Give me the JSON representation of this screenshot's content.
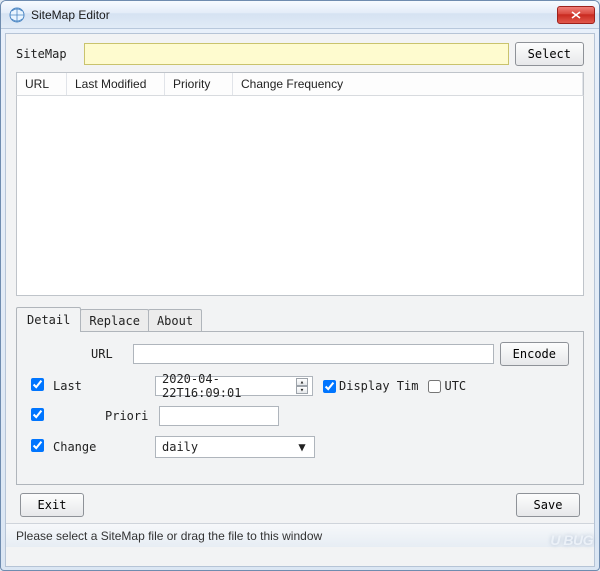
{
  "window": {
    "title": "SiteMap Editor"
  },
  "file_section": {
    "label": "SiteMap",
    "select_button": "Select",
    "path": ""
  },
  "grid": {
    "columns": {
      "url": "URL",
      "last_modified": "Last Modified",
      "priority": "Priority",
      "change_frequency": "Change Frequency"
    }
  },
  "tabs": {
    "detail": "Detail",
    "replace": "Replace",
    "about": "About"
  },
  "detail_form": {
    "url_label": "URL",
    "url_value": "",
    "encode_button": "Encode",
    "last_modified_label": "Last",
    "last_modified_value": "2020-04-22T16:09:01",
    "display_time_label": "Display Tim",
    "display_time_checked": true,
    "utc_label": "UTC",
    "utc_checked": false,
    "last_modified_checked": true,
    "priority_label": "Priori",
    "priority_value": "",
    "priority_checked": true,
    "change_label": "Change",
    "change_value": "daily",
    "change_checked": true
  },
  "buttons": {
    "exit": "Exit",
    "save": "Save"
  },
  "status": "Please select a SiteMap file or drag the file to this window",
  "watermark": "U BUG"
}
